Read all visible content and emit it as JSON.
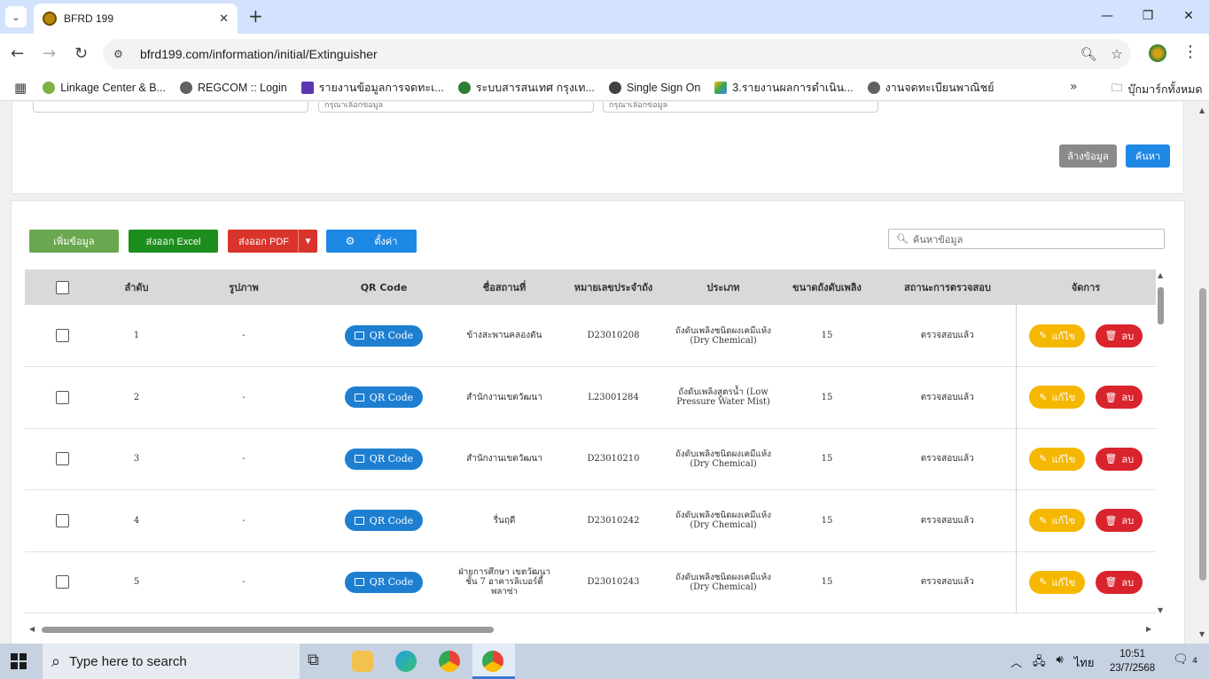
{
  "browser": {
    "tab_title": "BFRD 199",
    "url": "bfrd199.com/information/initial/Extinguisher",
    "bookmarks": [
      {
        "label": "Linkage Center & B...",
        "color": "#7cb342"
      },
      {
        "label": "REGCOM :: Login",
        "color": "#616161"
      },
      {
        "label": "รายงานข้อมูลการจดทะเ...",
        "color": "#5e35b1"
      },
      {
        "label": "ระบบสารสนเทศ กรุงเท...",
        "color": "#2e7d32"
      },
      {
        "label": "Single Sign On",
        "color": "#424242"
      },
      {
        "label": "3.รายงานผลการดำเนิน...",
        "color": "#fbbc04"
      },
      {
        "label": "งานจดทะเบียนพาณิชย์",
        "color": "#616161"
      }
    ],
    "bookmarks_folder": "บุ๊กมาร์กทั้งหมด"
  },
  "filter": {
    "input2_placeholder": "กรุณาเลือกข้อมูล",
    "input3_placeholder": "กรุณาเลือกข้อมูล",
    "clear_label": "ล้างข้อมูล",
    "search_label": "ค้นหา"
  },
  "actions": {
    "add_label": "เพิ่มข้อมูล",
    "excel_label": "ส่งออก Excel",
    "pdf_label": "ส่งออก PDF",
    "settings_label": "ตั้งค่า",
    "search_placeholder": "ค้นหาข้อมูล"
  },
  "table": {
    "headers": [
      "ลำดับ",
      "รูปภาพ",
      "QR Code",
      "ชื่อสถานที่",
      "หมายเลขประจำถัง",
      "ประเภท",
      "ขนาดถังดับเพลิง",
      "สถานะการตรวจสอบ",
      "จัดการ"
    ],
    "qr_label": "QR Code",
    "edit_label": "แก้ไข",
    "delete_label": "ลบ",
    "rows": [
      {
        "no": "1",
        "image": "-",
        "place": "ข้างสะพานคลองตัน",
        "tank_no": "D23010208",
        "type": "ถังดับเพลิงชนิดผงเคมีแห้ง (Dry Chemical)",
        "size": "15",
        "status": "ตรวจสอบแล้ว"
      },
      {
        "no": "2",
        "image": "-",
        "place": "สำนักงานเขตวัฒนา",
        "tank_no": "L23001284",
        "type": "ถังดับเพลิงสูตรน้ำ (Low Pressure Water Mist)",
        "size": "15",
        "status": "ตรวจสอบแล้ว"
      },
      {
        "no": "3",
        "image": "-",
        "place": "สำนักงานเขตวัฒนา",
        "tank_no": "D23010210",
        "type": "ถังดับเพลิงชนิดผงเคมีแห้ง (Dry Chemical)",
        "size": "15",
        "status": "ตรวจสอบแล้ว"
      },
      {
        "no": "4",
        "image": "-",
        "place": "รื่นฤดี",
        "tank_no": "D23010242",
        "type": "ถังดับเพลิงชนิดผงเคมีแห้ง (Dry Chemical)",
        "size": "15",
        "status": "ตรวจสอบแล้ว"
      },
      {
        "no": "5",
        "image": "-",
        "place": "ฝ่ายการศึกษา เขตวัฒนา ชั้น 7 อาคารลิเบอร์ตี้พลาซ่า",
        "tank_no": "D23010243",
        "type": "ถังดับเพลิงชนิดผงเคมีแห้ง (Dry Chemical)",
        "size": "15",
        "status": "ตรวจสอบแล้ว"
      }
    ]
  },
  "taskbar": {
    "search_placeholder": "Type here to search",
    "lang": "ไทย",
    "time": "10:51",
    "date": "23/7/2568",
    "notif_count": "4"
  }
}
